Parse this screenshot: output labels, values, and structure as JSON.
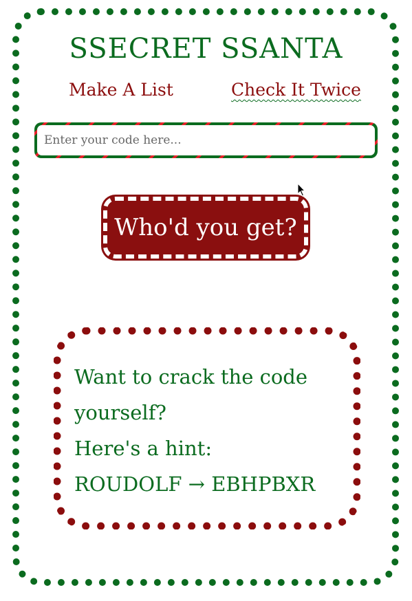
{
  "page": {
    "title": "SSECRET SSANTA"
  },
  "nav": {
    "make_list": "Make A List",
    "check_twice": "Check It Twice"
  },
  "code": {
    "placeholder": "Enter your code here..."
  },
  "action": {
    "button_label": "Who'd you get?"
  },
  "hint": {
    "line1": "Want to crack the code",
    "line2": "yourself?",
    "line3": "Here's a hint:",
    "line4": "ROUDOLF → EBHPBXR"
  },
  "colors": {
    "green": "#0b6b1f",
    "red": "#8b0d0d",
    "stripe_red": "#e8222b"
  },
  "icons": {
    "cursor": "mouse-pointer-icon"
  }
}
